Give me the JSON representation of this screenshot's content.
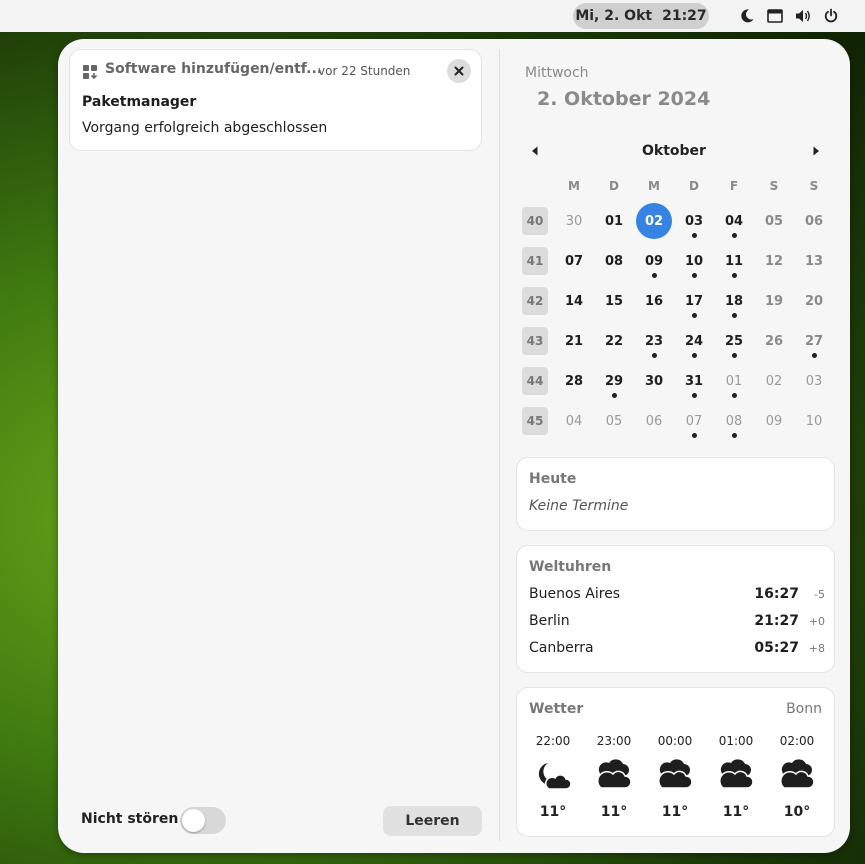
{
  "topbar": {
    "date": "Mi, 2. Okt",
    "time": "21:27",
    "tray_icons": [
      "moon-icon",
      "window-icon",
      "volume-icon",
      "power-icon"
    ]
  },
  "notification": {
    "app": "Software hinzufügen/entf...",
    "time": "vor 22 Stunden",
    "title": "Paketmanager",
    "body": "Vorgang erfolgreich abgeschlossen",
    "icon": "package-icon"
  },
  "dnd": {
    "label": "Nicht stören",
    "enabled": false
  },
  "clear_button": "Leeren",
  "calendar": {
    "weekday": "Mittwoch",
    "full_date": "2. Oktober 2024",
    "month": "Oktober",
    "day_headers": [
      "M",
      "D",
      "M",
      "D",
      "F",
      "S",
      "S"
    ],
    "weeks": [
      {
        "week": "40",
        "days": [
          {
            "d": "30",
            "t": "other"
          },
          {
            "d": "01",
            "t": "cur"
          },
          {
            "d": "02",
            "t": "today"
          },
          {
            "d": "03",
            "t": "cur",
            "e": true
          },
          {
            "d": "04",
            "t": "cur",
            "e": true
          },
          {
            "d": "05",
            "t": "wkend"
          },
          {
            "d": "06",
            "t": "wkend"
          }
        ]
      },
      {
        "week": "41",
        "days": [
          {
            "d": "07",
            "t": "cur"
          },
          {
            "d": "08",
            "t": "cur"
          },
          {
            "d": "09",
            "t": "cur",
            "e": true
          },
          {
            "d": "10",
            "t": "cur",
            "e": true
          },
          {
            "d": "11",
            "t": "cur",
            "e": true
          },
          {
            "d": "12",
            "t": "wkend"
          },
          {
            "d": "13",
            "t": "wkend"
          }
        ]
      },
      {
        "week": "42",
        "days": [
          {
            "d": "14",
            "t": "cur"
          },
          {
            "d": "15",
            "t": "cur"
          },
          {
            "d": "16",
            "t": "cur"
          },
          {
            "d": "17",
            "t": "cur",
            "e": true
          },
          {
            "d": "18",
            "t": "cur",
            "e": true
          },
          {
            "d": "19",
            "t": "wkend"
          },
          {
            "d": "20",
            "t": "wkend"
          }
        ]
      },
      {
        "week": "43",
        "days": [
          {
            "d": "21",
            "t": "cur"
          },
          {
            "d": "22",
            "t": "cur"
          },
          {
            "d": "23",
            "t": "cur",
            "e": true
          },
          {
            "d": "24",
            "t": "cur",
            "e": true
          },
          {
            "d": "25",
            "t": "cur",
            "e": true
          },
          {
            "d": "26",
            "t": "wkend"
          },
          {
            "d": "27",
            "t": "wkend",
            "e": true
          }
        ]
      },
      {
        "week": "44",
        "days": [
          {
            "d": "28",
            "t": "cur"
          },
          {
            "d": "29",
            "t": "cur",
            "e": true
          },
          {
            "d": "30",
            "t": "cur"
          },
          {
            "d": "31",
            "t": "cur",
            "e": true
          },
          {
            "d": "01",
            "t": "other",
            "e": true
          },
          {
            "d": "02",
            "t": "other"
          },
          {
            "d": "03",
            "t": "other"
          }
        ]
      },
      {
        "week": "45",
        "days": [
          {
            "d": "04",
            "t": "other"
          },
          {
            "d": "05",
            "t": "other"
          },
          {
            "d": "06",
            "t": "other"
          },
          {
            "d": "07",
            "t": "other",
            "e": true
          },
          {
            "d": "08",
            "t": "other",
            "e": true
          },
          {
            "d": "09",
            "t": "other"
          },
          {
            "d": "10",
            "t": "other"
          }
        ]
      }
    ]
  },
  "today_card": {
    "title": "Heute",
    "empty": "Keine Termine"
  },
  "world_clocks": {
    "title": "Weltuhren",
    "rows": [
      {
        "city": "Buenos Aires",
        "time": "16:27",
        "offset": "-5"
      },
      {
        "city": "Berlin",
        "time": "21:27",
        "offset": "+0"
      },
      {
        "city": "Canberra",
        "time": "05:27",
        "offset": "+8"
      }
    ]
  },
  "weather": {
    "title": "Wetter",
    "location": "Bonn",
    "hours": [
      {
        "time": "22:00",
        "icon": "night-cloudy-icon",
        "temp": "11°"
      },
      {
        "time": "23:00",
        "icon": "rain-cloud-icon",
        "temp": "11°"
      },
      {
        "time": "00:00",
        "icon": "rain-cloud-icon",
        "temp": "11°"
      },
      {
        "time": "01:00",
        "icon": "rain-cloud-icon",
        "temp": "11°"
      },
      {
        "time": "02:00",
        "icon": "rain-cloud-icon",
        "temp": "10°"
      }
    ]
  }
}
